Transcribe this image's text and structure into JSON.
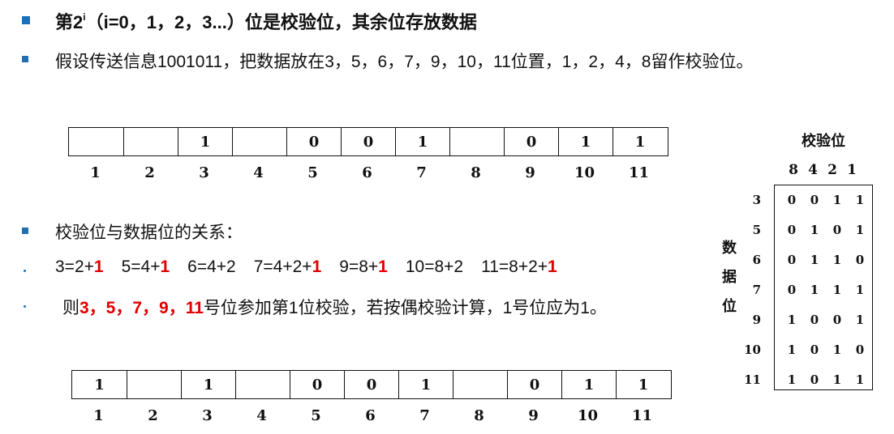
{
  "heading": {
    "text_pre": "第2",
    "sup": "i",
    "text_post": "（i=0，1，2，3...）位是校验位，其余位存放数据"
  },
  "intro": "假设传送信息1001011，把数据放在3，5，6，7，9，10，11位置，1，2，4，8留作校验位。",
  "top_register": {
    "cells": [
      "",
      "",
      "1",
      "",
      "0",
      "0",
      "1",
      "",
      "0",
      "1",
      "1"
    ],
    "positions": [
      "1",
      "2",
      "3",
      "4",
      "5",
      "6",
      "7",
      "8",
      "9",
      "10",
      "11"
    ]
  },
  "relation_title": "校验位与数据位的关系：",
  "relations": [
    {
      "expr": "3=2+",
      "red": "1"
    },
    {
      "expr": "5=4+",
      "red": "1"
    },
    {
      "expr": "6=4+2",
      "red": ""
    },
    {
      "expr": "7=4+2+",
      "red": "1"
    },
    {
      "expr": "9=8+",
      "red": "1"
    },
    {
      "expr": "10=8+2",
      "red": ""
    },
    {
      "expr": "11=8+2+",
      "red": "1"
    }
  ],
  "conclusion": {
    "pre": "则",
    "red": "3，5，7，9，11",
    "post": "号位参加第1位校验，若按偶校验计算，1号位应为1。"
  },
  "bottom_register": {
    "cells": [
      "1",
      "",
      "1",
      "",
      "0",
      "0",
      "1",
      "",
      "0",
      "1",
      "1"
    ],
    "positions": [
      "1",
      "2",
      "3",
      "4",
      "5",
      "6",
      "7",
      "8",
      "9",
      "10",
      "11"
    ]
  },
  "check_table": {
    "title": "校验位",
    "column_headers": [
      "8",
      "4",
      "2",
      "1"
    ],
    "side_label": [
      "数",
      "据",
      "位"
    ],
    "rows": [
      {
        "label": "3",
        "bits": [
          "0",
          "0",
          "1",
          "1"
        ]
      },
      {
        "label": "5",
        "bits": [
          "0",
          "1",
          "0",
          "1"
        ]
      },
      {
        "label": "6",
        "bits": [
          "0",
          "1",
          "1",
          "0"
        ]
      },
      {
        "label": "7",
        "bits": [
          "0",
          "1",
          "1",
          "1"
        ]
      },
      {
        "label": "9",
        "bits": [
          "1",
          "0",
          "0",
          "1"
        ]
      },
      {
        "label": "10",
        "bits": [
          "1",
          "0",
          "1",
          "0"
        ]
      },
      {
        "label": "11",
        "bits": [
          "1",
          "0",
          "1",
          "1"
        ]
      }
    ]
  }
}
